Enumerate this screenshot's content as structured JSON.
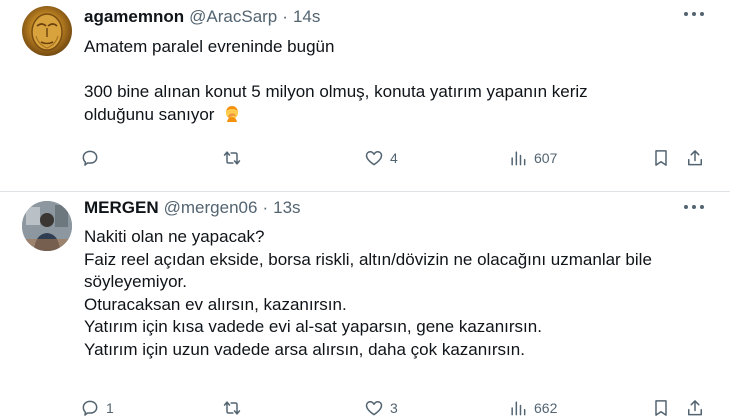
{
  "tweets": [
    {
      "name": "agamemnon",
      "handle": "@AracSarp",
      "separator": "·",
      "time": "14s",
      "lines": [
        "Amatem paralel evreninde bugün",
        "",
        "300 bine alınan konut 5 milyon olmuş, konuta yatırım yapanın keriz",
        "olduğunu sanıyor"
      ],
      "emoji_icon": "person-facepalming-emoji",
      "replies": "",
      "retweets": "",
      "likes": "4",
      "views": "607"
    },
    {
      "name": "MERGEN",
      "handle": "@mergen06",
      "separator": "·",
      "time": "13s",
      "lines": [
        "Nakiti olan ne yapacak?",
        "Faiz reel açıdan ekside, borsa riskli, altın/dövizin ne olacağını uzmanlar bile",
        "söyleyemiyor.",
        "Oturacaksan ev alırsın, kazanırsın.",
        "Yatırım için kısa vadede evi al-sat yaparsın, gene kazanırsın.",
        "Yatırım için uzun vadede arsa alırsın, daha çok kazanırsın."
      ],
      "replies": "1",
      "retweets": "",
      "likes": "3",
      "views": "662"
    }
  ],
  "icons": {
    "more": "more-options-icon",
    "reply": "reply-icon",
    "retweet": "retweet-icon",
    "like": "like-icon",
    "views": "views-icon",
    "bookmark": "bookmark-icon",
    "share": "share-icon"
  },
  "colors": {
    "text": "#0f1419",
    "secondary": "#536471",
    "divider": "#dfe3e6",
    "background": "#ffffff"
  }
}
